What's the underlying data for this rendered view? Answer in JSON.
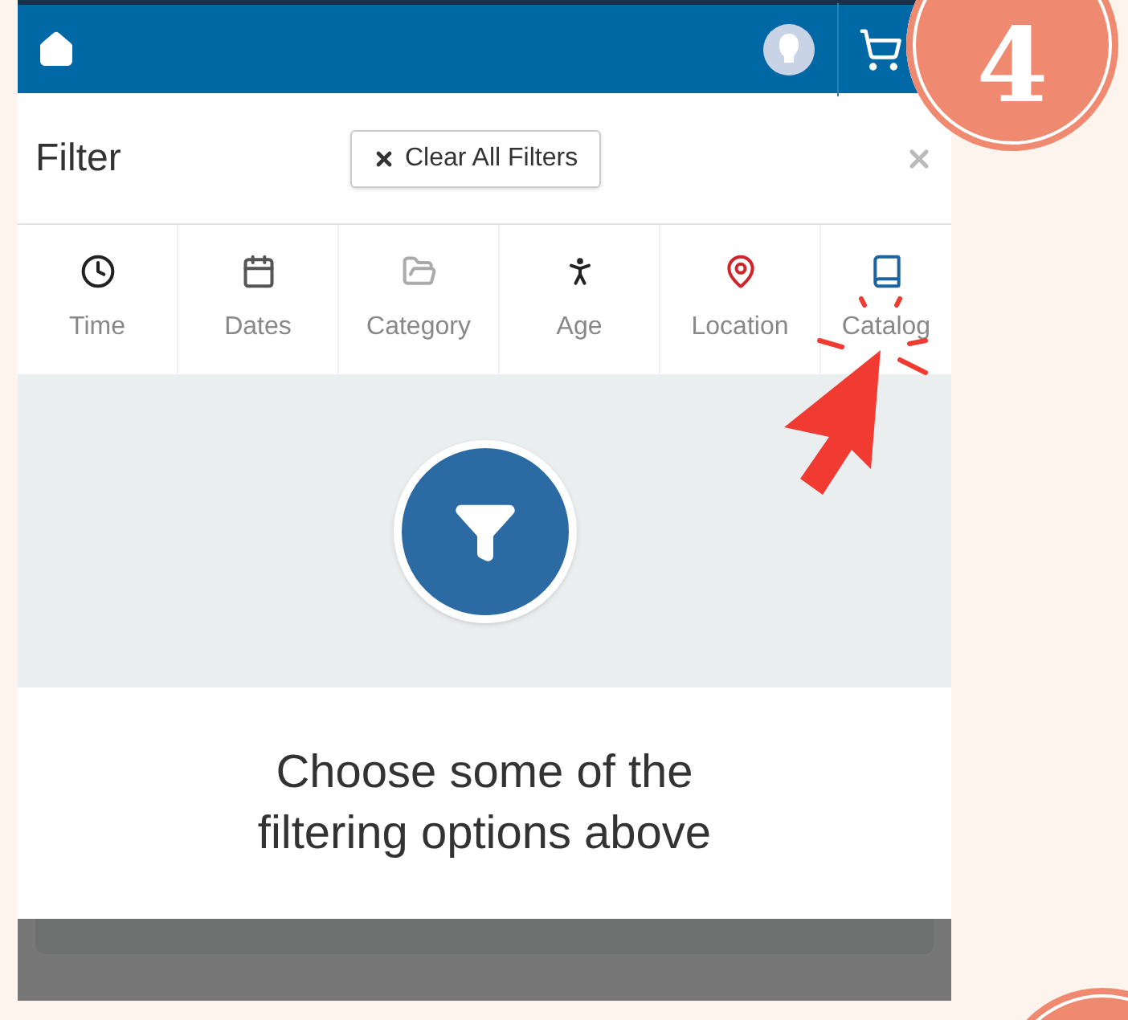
{
  "header": {
    "step_badge": "4"
  },
  "filter": {
    "title": "Filter",
    "clear_button": "Clear All Filters"
  },
  "tabs": [
    {
      "label": "Time",
      "kind": "clock",
      "color": "#222222"
    },
    {
      "label": "Dates",
      "kind": "calendar",
      "color": "#555555"
    },
    {
      "label": "Category",
      "kind": "folder",
      "color": "#aaaaaa"
    },
    {
      "label": "Age",
      "kind": "person",
      "color": "#222222"
    },
    {
      "label": "Location",
      "kind": "pin",
      "color": "#d0242b"
    },
    {
      "label": "Catalog",
      "kind": "book",
      "color": "#1b64a0"
    }
  ],
  "empty_state": {
    "message": "Choose some of the filtering options above"
  }
}
